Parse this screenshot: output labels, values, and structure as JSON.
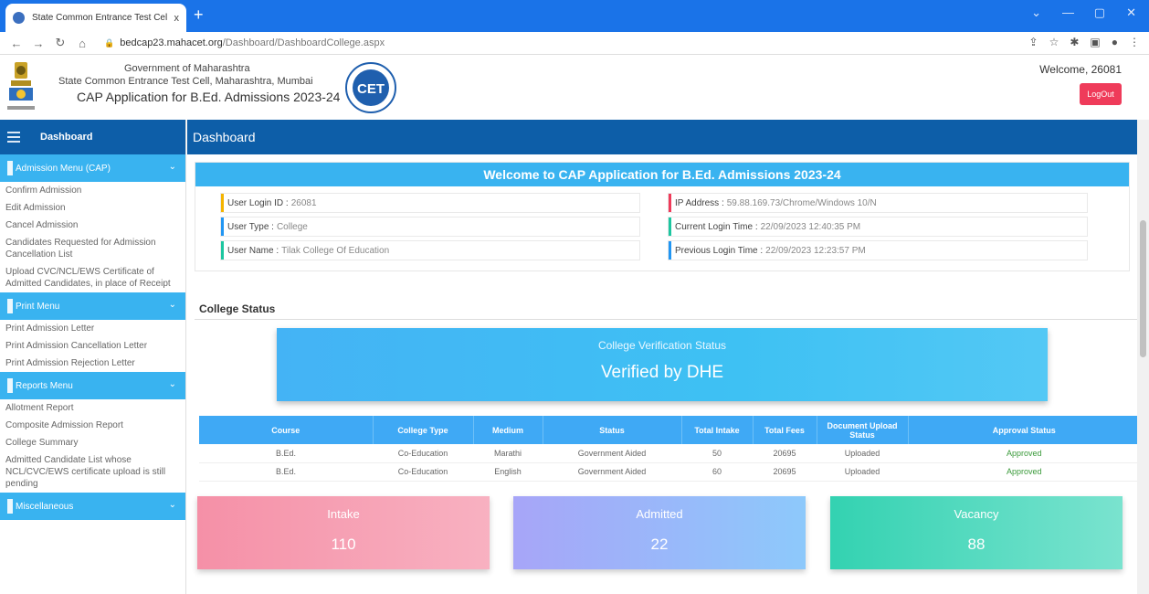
{
  "browser": {
    "tab_title": "State Common Entrance Test Cel",
    "tab_close": "x",
    "new_tab": "+",
    "url_host": "bedcap23.mahacet.org",
    "url_path": "/Dashboard/DashboardCollege.aspx"
  },
  "header": {
    "line1": "Government of Maharashtra",
    "line2": "State Common Entrance Test Cell, Maharashtra, Mumbai",
    "line3": "CAP Application for B.Ed. Admissions 2023-24",
    "welcome": "Welcome, 26081",
    "logout_label": "LogOut",
    "cet_logo_text": "CET"
  },
  "sidebar": {
    "dashboard_label": "Dashboard",
    "menus": [
      {
        "title": "Admission Menu (CAP)",
        "items": [
          "Confirm Admission",
          "Edit Admission",
          "Cancel Admission",
          "Candidates Requested for Admission Cancellation List",
          "Upload CVC/NCL/EWS Certificate of Admitted Candidates, in place of Receipt"
        ]
      },
      {
        "title": "Print Menu",
        "items": [
          "Print Admission Letter",
          "Print Admission Cancellation Letter",
          "Print Admission Rejection Letter"
        ]
      },
      {
        "title": "Reports Menu",
        "items": [
          "Allotment Report",
          "Composite Admission Report",
          "College Summary",
          "Admitted Candidate List whose NCL/CVC/EWS certificate upload is still pending"
        ]
      },
      {
        "title": "Miscellaneous",
        "items": []
      }
    ]
  },
  "main": {
    "title": "Dashboard",
    "welcome_banner": "Welcome to CAP Application for B.Ed. Admissions 2023-24",
    "info": {
      "login_id_label": "User Login ID :",
      "login_id": "26081",
      "user_type_label": "User Type :",
      "user_type": "College",
      "user_name_label": "User Name :",
      "user_name": "Tilak College Of Education",
      "ip_label": "IP Address :",
      "ip": "59.88.169.73/Chrome/Windows 10/N",
      "current_login_label": "Current Login Time :",
      "current_login": "22/09/2023 12:40:35 PM",
      "previous_login_label": "Previous Login Time :",
      "previous_login": "22/09/2023 12:23:57 PM"
    },
    "college_status_title": "College Status",
    "verification": {
      "title": "College Verification Status",
      "value": "Verified by DHE"
    },
    "table": {
      "headers": [
        "Course",
        "College Type",
        "Medium",
        "Status",
        "Total Intake",
        "Total Fees",
        "Document Upload Status",
        "Approval Status"
      ],
      "rows": [
        [
          "B.Ed.",
          "Co-Education",
          "Marathi",
          "Government Aided",
          "50",
          "20695",
          "Uploaded",
          "Approved"
        ],
        [
          "B.Ed.",
          "Co-Education",
          "English",
          "Government Aided",
          "60",
          "20695",
          "Uploaded",
          "Approved"
        ]
      ]
    },
    "stats": {
      "intake_label": "Intake",
      "intake": "110",
      "admitted_label": "Admitted",
      "admitted": "22",
      "vacancy_label": "Vacancy",
      "vacancy": "88"
    }
  },
  "colors": {
    "header_blue": "#0d5ea8",
    "menu_blue": "#39b3f0",
    "logout_red": "#ef3b5a",
    "approved_green": "#3a9a3a"
  }
}
